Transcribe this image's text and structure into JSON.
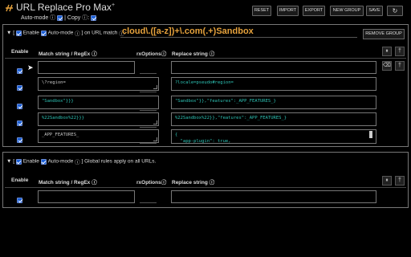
{
  "app": {
    "title": "URL Replace Pro Max",
    "title_sup": "+",
    "auto_mode_label": "Auto-mode",
    "info": "ⓘ",
    "sep": "|",
    "copy_label": "Copy",
    "colon": ":"
  },
  "toolbar": {
    "reset": "RESET",
    "import": "IMPORT",
    "export": "EXPORT",
    "new_group": "NEW GROUP",
    "save": "SAVE",
    "refresh_icon": "↻"
  },
  "group1": {
    "toggle": "▼",
    "bracket_open": "[",
    "enable_label": "Enable",
    "auto_mode_label": "Auto-mode",
    "mode_text": "] on URL match",
    "url_pattern": "cloud\\.([a-z])+\\.com(.+)Sandbox",
    "remove_label": "REMOVE GROUP",
    "headers": {
      "enable": "Enable",
      "match": "Match string / RegEx ⓘ",
      "options": "rxOptionsⓘ",
      "replace": "Replace string ⓘ"
    },
    "rows": [
      {
        "match": "",
        "replace": ""
      },
      {
        "match": "\\?region=",
        "replace": "?locale=pseudo#region="
      },
      {
        "match": "\"Sandbox\"}}}",
        "replace": "\"Sandbox\"}},\"features\":_APP_FEATURES_}"
      },
      {
        "match": "%22Sandbox%22}}}",
        "replace": "%22Sandbox%22}},\"features\":_APP_FEATURES_}"
      },
      {
        "match": "_APP_FEATURES_",
        "replace": "{\n  \"app-plugin\": true,"
      }
    ]
  },
  "group2": {
    "toggle": "▼",
    "bracket_open": "[",
    "enable_label": "Enable",
    "auto_mode_label": "Auto-mode",
    "mode_text": "] Global rules apply on all URLs.",
    "headers": {
      "enable": "Enable",
      "match": "Match string / RegEx ⓘ",
      "options": "rxOptionsⓘ",
      "replace": "Replace string ⓘ"
    },
    "rows": [
      {
        "match": "",
        "replace": ""
      }
    ]
  },
  "icons": {
    "pause": "⏸",
    "add": "†",
    "delete": "⌫"
  },
  "colors": {
    "accent": "#e6a23c",
    "code_text": "#2ec4b6",
    "checkbox": "#1a5fd6"
  }
}
